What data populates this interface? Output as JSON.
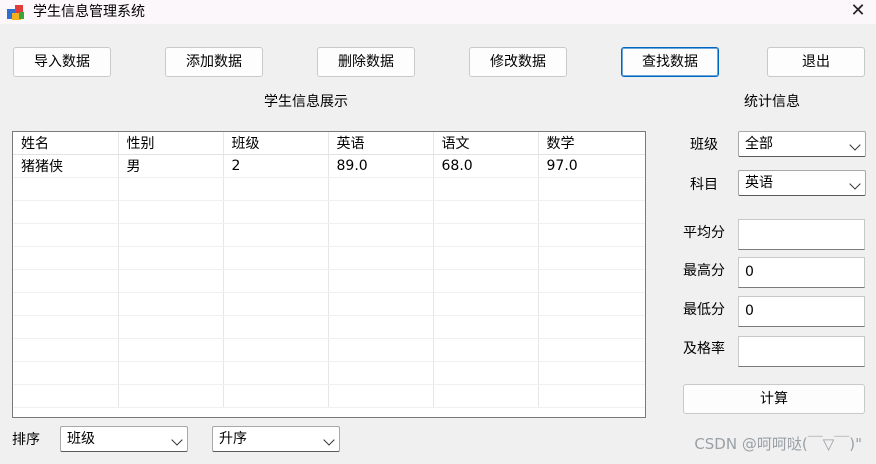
{
  "window": {
    "title": "学生信息管理系统"
  },
  "toolbar": {
    "import": "导入数据",
    "add": "添加数据",
    "delete": "删除数据",
    "modify": "修改数据",
    "search": "查找数据",
    "exit": "退出"
  },
  "display": {
    "title": "学生信息展示",
    "columns": [
      "姓名",
      "性别",
      "班级",
      "英语",
      "语文",
      "数学"
    ],
    "rows": [
      [
        "猪猪侠",
        "男",
        "2",
        "89.0",
        "68.0",
        "97.0"
      ]
    ],
    "empty_rows": 10
  },
  "stats": {
    "title": "统计信息",
    "class_label": "班级",
    "class_value": "全部",
    "subject_label": "科目",
    "subject_value": "英语",
    "avg_label": "平均分",
    "avg_value": "",
    "max_label": "最高分",
    "max_value": "0",
    "min_label": "最低分",
    "min_value": "0",
    "pass_label": "及格率",
    "pass_value": "",
    "compute": "计算"
  },
  "sort": {
    "label": "排序",
    "field_value": "班级",
    "order_value": "升序"
  },
  "watermark": "CSDN @呵呵哒(￣▽￣)\"",
  "colors": {
    "focus_border": "#0067c0",
    "background": "#f0f0f0"
  }
}
